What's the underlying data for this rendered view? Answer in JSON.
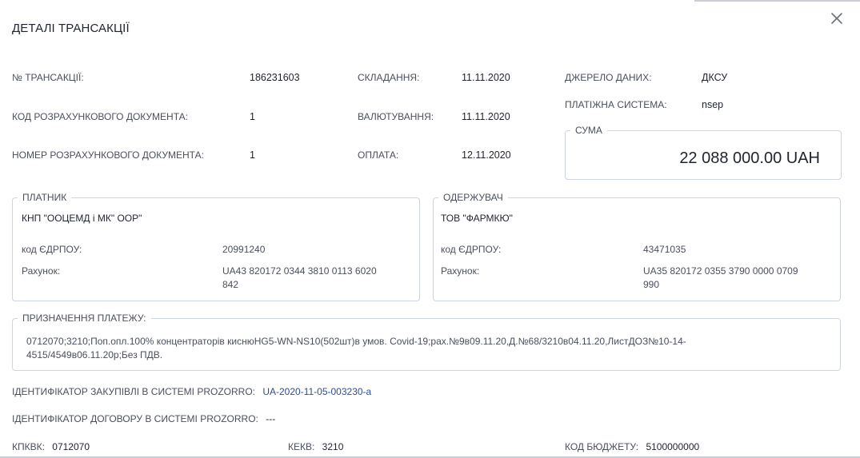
{
  "modal": {
    "title": "ДЕТАЛІ ТРАНСАКЦІЇ"
  },
  "fields": {
    "transaction_no_label": "№ ТРАНСАКЦІЇ:",
    "transaction_no": "186231603",
    "doc_code_label": "КОД РОЗРАХУНКОВОГО ДОКУМЕНТА:",
    "doc_code": "1",
    "doc_number_label": "НОМЕР РОЗРАХУНКОВОГО ДОКУМЕНТА:",
    "doc_number": "1",
    "compiled_label": "СКЛАДАННЯ:",
    "compiled": "11.11.2020",
    "valuation_label": "ВАЛЮТУВАННЯ:",
    "valuation": "11.11.2020",
    "payment_label": "ОПЛАТА:",
    "payment": "12.11.2020",
    "source_label": "ДЖЕРЕЛО ДАНИХ:",
    "source": "ДКСУ",
    "system_label": "ПЛАТІЖНА СИСТЕМА:",
    "system": "nsep"
  },
  "sum": {
    "legend": "СУМА",
    "value": "22 088 000.00 UAH"
  },
  "payer": {
    "legend": "ПЛАТНИК",
    "name": "КНП \"ООЦЕМД і МК\" ООР\"",
    "edrpou_label": "код ЄДРПОУ:",
    "edrpou": "20991240",
    "account_label": "Рахунок:",
    "account_line1": "UA43 820172 0344 3810 0113 6020",
    "account_line2": "842"
  },
  "receiver": {
    "legend": "ОДЕРЖУВАЧ",
    "name": "ТОВ \"ФАРМКЮ\"",
    "edrpou_label": "код ЄДРПОУ:",
    "edrpou": "43471035",
    "account_label": "Рахунок:",
    "account_line1": "UA35 820172 0355 3790 0000 0709",
    "account_line2": "990"
  },
  "purpose": {
    "legend": "ПРИЗНАЧЕННЯ ПЛАТЕЖУ:",
    "line1": "0712070;3210;Поп.опл.100% концентраторів киснюHG5-WN-NS10(502шт)в умов. Covid-19;рах.№9в09.11.20,Д.№68/3210в04.11.20,ЛистДОЗ№10-14-",
    "line2": "4515/4549в06.11.20р;Без ПДВ."
  },
  "prozorro": {
    "procurement_label": "ІДЕНТИФІКАТОР ЗАКУПІВЛІ В СИСТЕМІ PROZORRO:",
    "procurement_id": "UA-2020-11-05-003230-a",
    "contract_label": "ІДЕНТИФІКАТОР ДОГОВОРУ В СИСТЕМІ PROZORRO:",
    "contract_id": "---"
  },
  "codes": {
    "kpkvk_label": "КПКВК:",
    "kpkvk": "0712070",
    "kekv_label": "КЕКВ:",
    "kekv": "3210",
    "budget_label": "КОД БЮДЖЕТУ:",
    "budget": "5100000000"
  },
  "icons": {
    "close": "close-icon"
  },
  "colors": {
    "link": "#2d4d8f",
    "border": "#cfd5df",
    "text": "#1f2330",
    "muted": "#4a4f5c"
  }
}
